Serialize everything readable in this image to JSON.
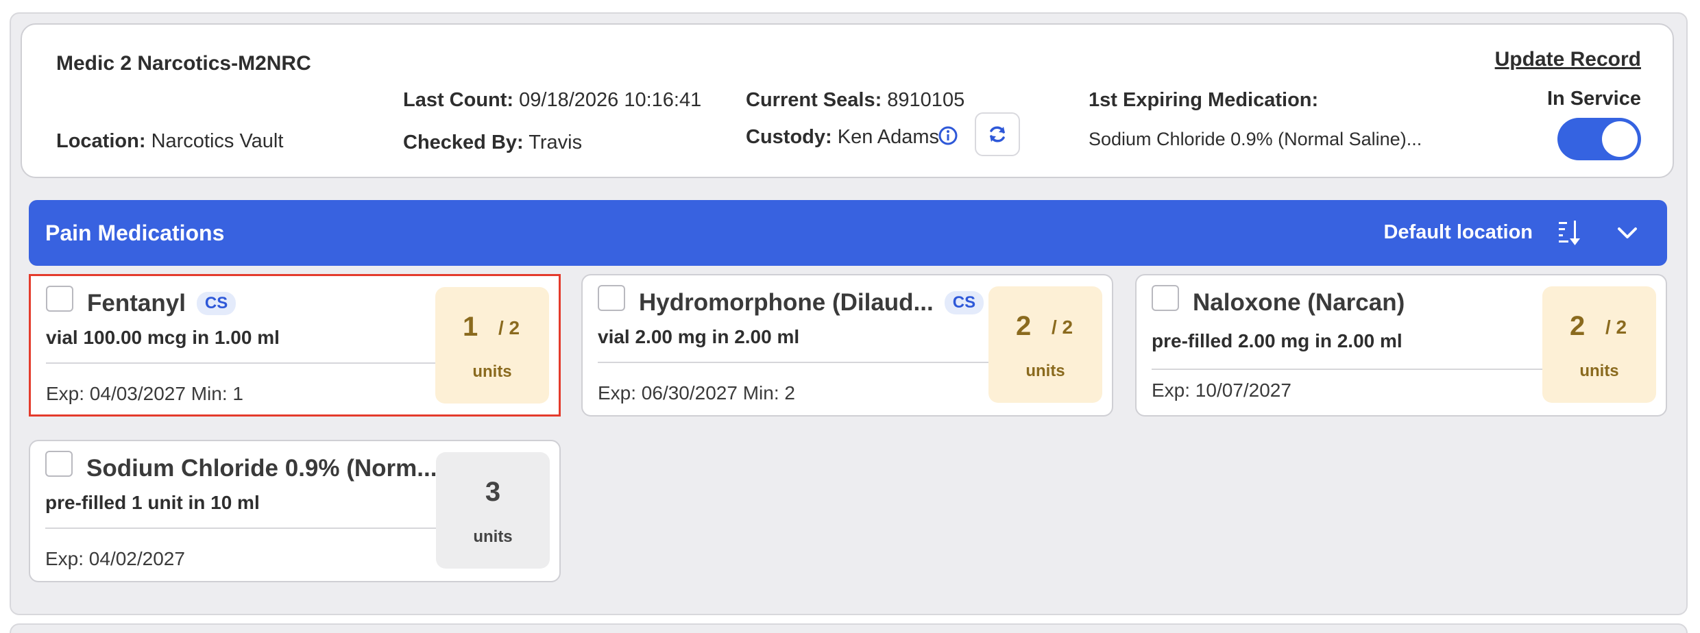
{
  "header": {
    "title": "Medic 2 Narcotics-M2NRC",
    "location_label": "Location:",
    "location_value": "Narcotics Vault",
    "last_count_label": "Last Count:",
    "last_count_value": "09/18/2026 10:16:41",
    "checked_by_label": "Checked By:",
    "checked_by_value": "Travis",
    "current_seals_label": "Current Seals:",
    "current_seals_value": "8910105",
    "custody_label": "Custody:",
    "custody_value": "Ken Adams",
    "expiring_label": "1st Expiring Medication:",
    "expiring_value": "Sodium Chloride 0.9% (Normal Saline)...",
    "update_record": "Update Record",
    "in_service_label": "In Service",
    "in_service_on": true
  },
  "section": {
    "title": "Pain Medications",
    "location": "Default location",
    "accent": "#3862e0"
  },
  "medications": [
    {
      "name": "Fentanyl",
      "badge": "CS",
      "desc": "vial 100.00 mcg in 1.00 ml",
      "exp": "Exp: 04/03/2027 Min: 1",
      "qty": "1",
      "of": "/ 2",
      "units": "units",
      "selected": true
    },
    {
      "name": "Hydromorphone (Dilaud...",
      "badge": "CS",
      "desc": "vial 2.00 mg in 2.00 ml",
      "exp": "Exp: 06/30/2027 Min: 2",
      "qty": "2",
      "of": "/ 2",
      "units": "units",
      "selected": false
    },
    {
      "name": "Naloxone (Narcan)",
      "badge": "",
      "desc": "pre-filled 2.00 mg in 2.00 ml",
      "exp": "Exp: 10/07/2027",
      "qty": "2",
      "of": "/ 2",
      "units": "units",
      "selected": false
    },
    {
      "name": "Sodium Chloride 0.9% (Norm...",
      "badge": "",
      "desc": "pre-filled 1 unit in 10 ml",
      "exp": "Exp: 04/02/2027",
      "qty": "3",
      "of": "",
      "units": "units",
      "selected": false
    }
  ],
  "colors": {
    "selection_border": "#e43b2c",
    "qty_warning_bg": "#fdf0d6",
    "qty_neutral_bg": "#ededee",
    "toggle_on": "#3563e1"
  }
}
